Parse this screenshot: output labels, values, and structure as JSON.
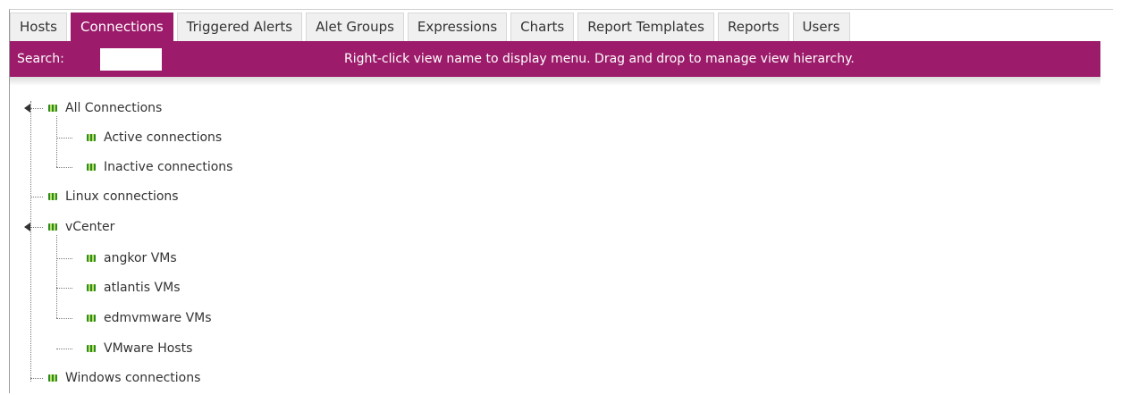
{
  "tabs": [
    {
      "label": "Hosts",
      "active": false
    },
    {
      "label": "Connections",
      "active": true
    },
    {
      "label": "Triggered Alerts",
      "active": false
    },
    {
      "label": "Alet Groups",
      "active": false
    },
    {
      "label": "Expressions",
      "active": false
    },
    {
      "label": "Charts",
      "active": false
    },
    {
      "label": "Report Templates",
      "active": false
    },
    {
      "label": "Reports",
      "active": false
    },
    {
      "label": "Users",
      "active": false
    }
  ],
  "search": {
    "label": "Search:",
    "value": "",
    "hint": "Right-click view name to display menu. Drag and drop to manage view hierarchy."
  },
  "tree": {
    "all_connections": "All Connections",
    "active_connections": "Active connections",
    "inactive_connections": "Inactive connections",
    "linux_connections": "Linux connections",
    "vcenter": "vCenter",
    "angkor_vms": "angkor VMs",
    "atlantis_vms": "atlantis VMs",
    "edmvmware_vms": "edmvmware VMs",
    "vmware_hosts": "VMware Hosts",
    "windows_connections": "Windows connections"
  },
  "colors": {
    "accent": "#9c1b6a",
    "view_icon": "#2f8a22"
  },
  "icons": {
    "view": "view-group-icon",
    "expander": "tree-expander-icon"
  }
}
